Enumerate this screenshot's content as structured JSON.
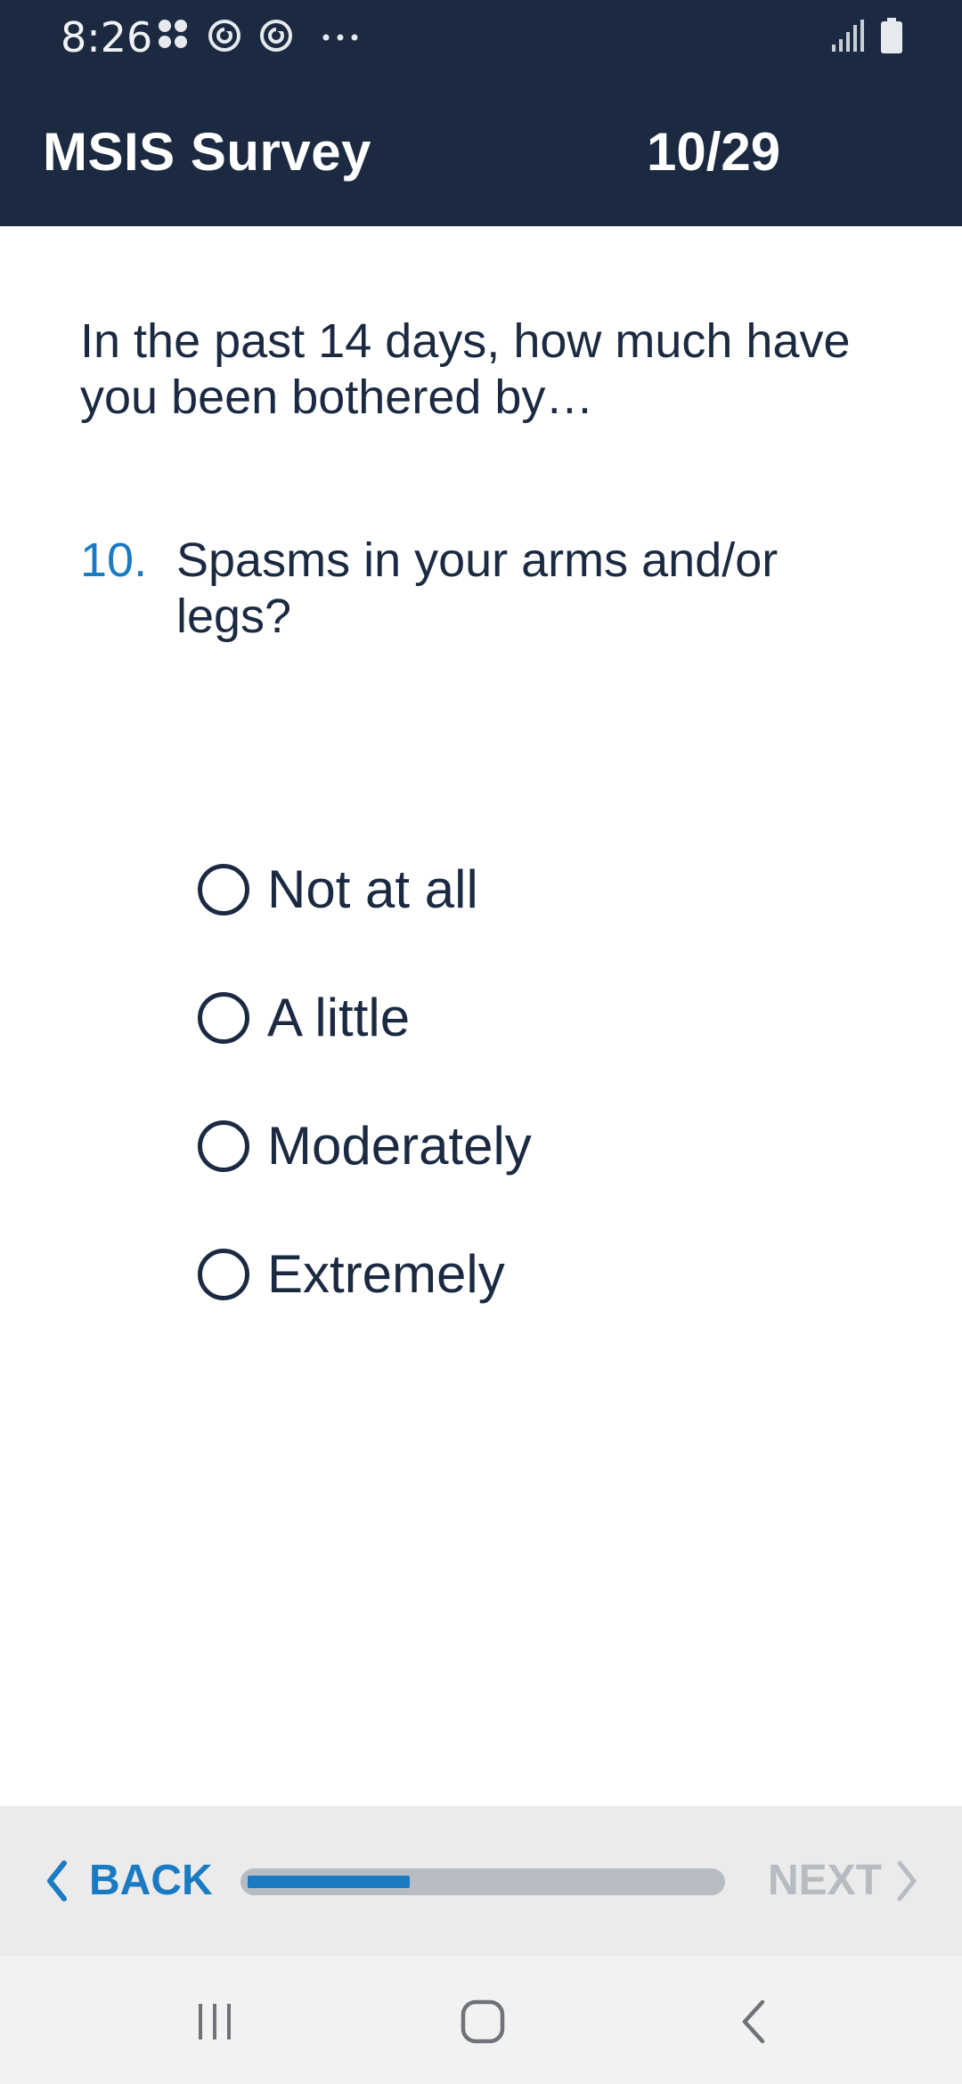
{
  "status_bar": {
    "time": "8:26",
    "background": "#1b2a41",
    "left_icons": [
      "apps-grid-icon",
      "sync-icon",
      "sync-icon",
      "more-dots-icon"
    ],
    "right_icons": [
      "signal-icon",
      "battery-icon"
    ]
  },
  "app_bar": {
    "title": "MSIS Survey",
    "progress_text": "10/29",
    "background": "#1b2a41"
  },
  "survey": {
    "instruction": "In the past 14 days, how much have you been bothered by…",
    "question_number": "10.",
    "question_text": "Spasms in your arms and/or legs?",
    "options": [
      {
        "label": "Not at all",
        "selected": false
      },
      {
        "label": "A little",
        "selected": false
      },
      {
        "label": "Moderately",
        "selected": false
      },
      {
        "label": "Extremely",
        "selected": false
      }
    ]
  },
  "footer": {
    "back_label": "BACK",
    "next_label": "NEXT",
    "next_enabled": false,
    "progress_fraction": 0.345,
    "accent_color": "#1a7ac2",
    "disabled_color": "#b7bcc2"
  },
  "nav_bar": {
    "buttons": [
      "recent-apps-icon",
      "home-icon",
      "back-icon"
    ]
  }
}
